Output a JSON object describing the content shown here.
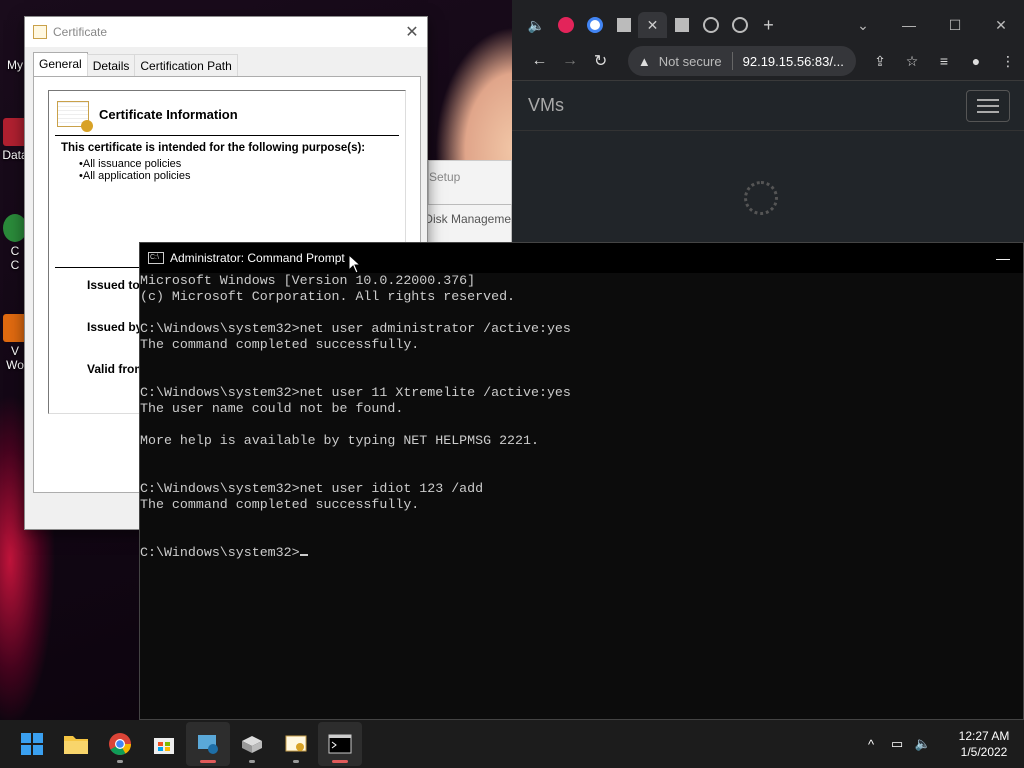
{
  "desktop": {
    "icons": [
      {
        "label": "My",
        "color": "#3b82c4"
      },
      {
        "label": "Data",
        "color": "#b02030"
      },
      {
        "label": "C\nC",
        "color": "#2a8a3a"
      },
      {
        "label": "V\nWo",
        "color": "#e06a10"
      }
    ]
  },
  "certificate": {
    "title": "Certificate",
    "tabs": [
      "General",
      "Details",
      "Certification Path"
    ],
    "info_heading": "Certificate Information",
    "purpose_text": "This certificate is intended for the following purpose(s):",
    "purposes": [
      "All issuance policies",
      "All application policies"
    ],
    "fields": [
      "Issued to:",
      "Issued by",
      "Valid from"
    ]
  },
  "background_windows": {
    "setup_title": "Setup",
    "disk_title": "Disk Manageme"
  },
  "browser": {
    "tabs": [
      {
        "icon": "speaker-icon"
      },
      {
        "icon": "quora-icon",
        "color": "#e3245a"
      },
      {
        "icon": "google-icon"
      },
      {
        "icon": "server-icon"
      },
      {
        "icon": "close-icon"
      },
      {
        "icon": "server-icon"
      },
      {
        "icon": "globe-icon"
      },
      {
        "icon": "globe-icon"
      }
    ],
    "new_tab": "+",
    "security_text": "Not secure",
    "url": "92.19.15.56:83/...",
    "page_brand": "VMs"
  },
  "cmd": {
    "title": "Administrator: Command Prompt",
    "lines": [
      "Microsoft Windows [Version 10.0.22000.376]",
      "(c) Microsoft Corporation. All rights reserved.",
      "",
      "C:\\Windows\\system32>net user administrator /active:yes",
      "The command completed successfully.",
      "",
      "",
      "C:\\Windows\\system32>net user 11 Xtremelite /active:yes",
      "The user name could not be found.",
      "",
      "More help is available by typing NET HELPMSG 2221.",
      "",
      "",
      "C:\\Windows\\system32>net user idiot 123 /add",
      "The command completed successfully.",
      "",
      "",
      "C:\\Windows\\system32>"
    ]
  },
  "taskbar": {
    "apps": [
      "start-button",
      "file-explorer",
      "chrome",
      "microsoft-store",
      "remote-desktop",
      "server-manager",
      "certificate-manager",
      "command-prompt"
    ],
    "time": "12:27 AM",
    "date": "1/5/2022"
  }
}
